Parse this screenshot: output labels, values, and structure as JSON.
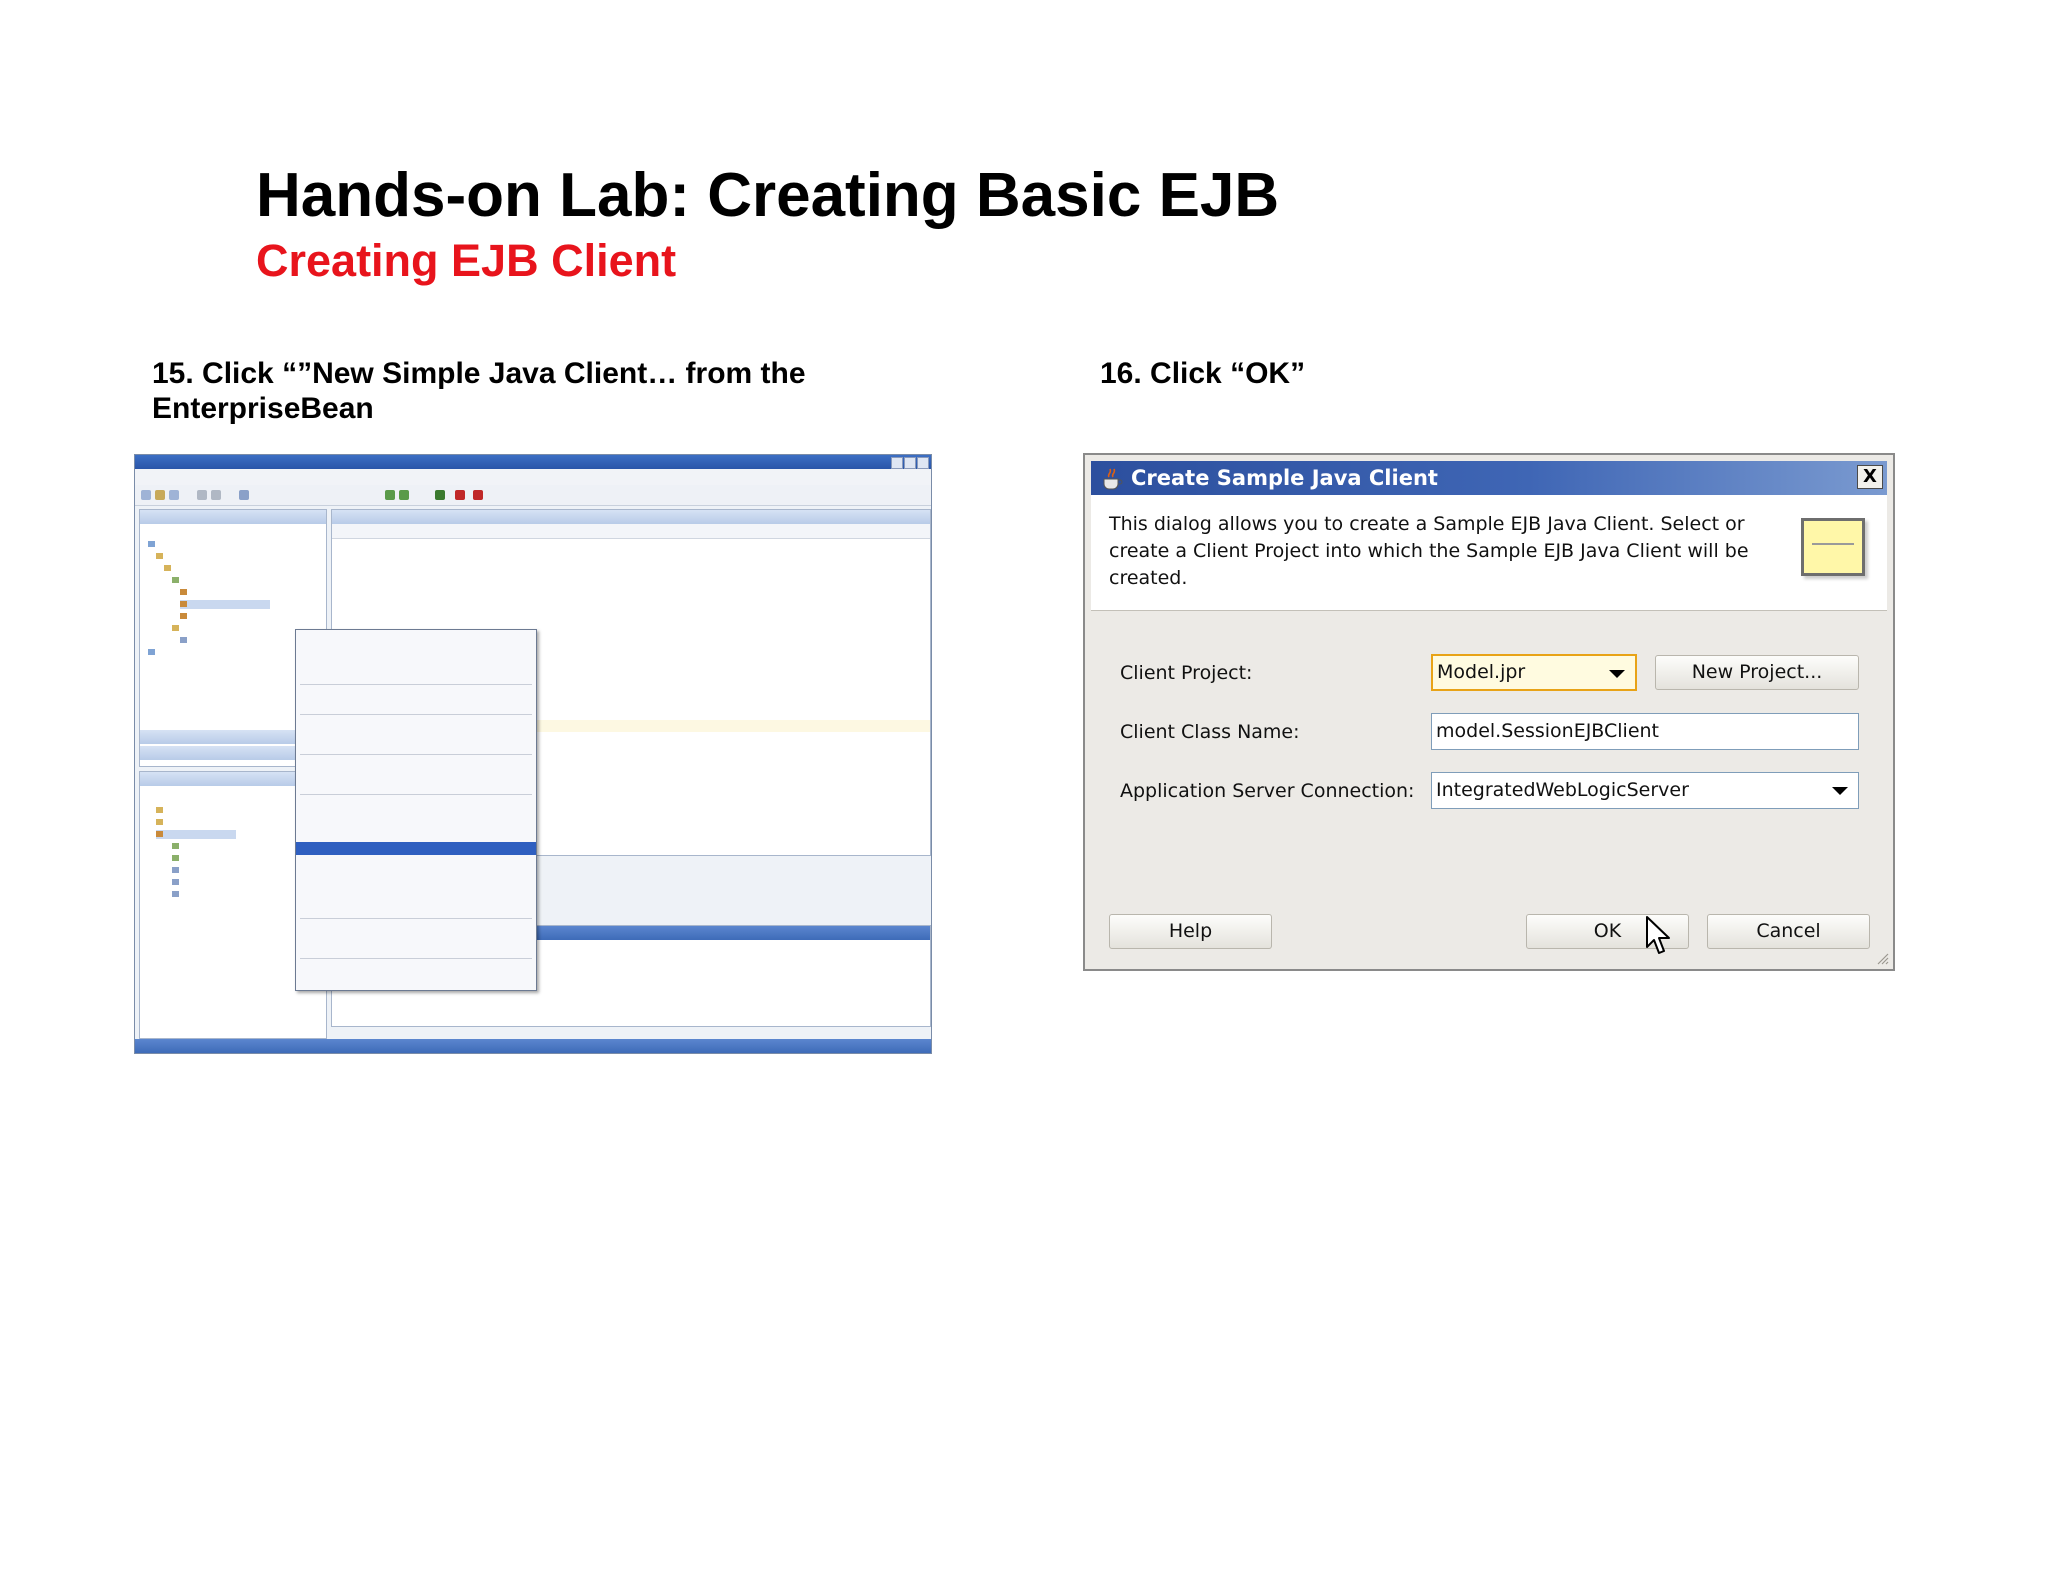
{
  "slide": {
    "title": "Hands-on Lab: Creating Basic EJB",
    "subtitle": "Creating EJB Client",
    "step15": "15. Click “”New Simple Java Client… from the EnterpriseBean",
    "step16": "16. Click “OK”"
  },
  "dialog": {
    "title": "Create Sample Java Client",
    "close_label": "X",
    "description": "This dialog allows you to create a Sample EJB Java Client. Select or create a Client Project into which the Sample EJB Java Client will be created.",
    "client_project_label": "Client Project:",
    "client_project_value": "Model.jpr",
    "new_project_button": "New Project...",
    "client_class_label": "Client Class Name:",
    "client_class_value": "model.SessionEJBClient",
    "app_server_label": "Application Server Connection:",
    "app_server_value": "IntegratedWebLogicServer",
    "help_button": "Help",
    "ok_button": "OK",
    "cancel_button": "Cancel"
  },
  "colors": {
    "subtitle": "#e8141c",
    "dialog_title_bar": "#2c4f9e",
    "focus_border": "#e8a317",
    "context_selection": "#2f5fc0"
  }
}
